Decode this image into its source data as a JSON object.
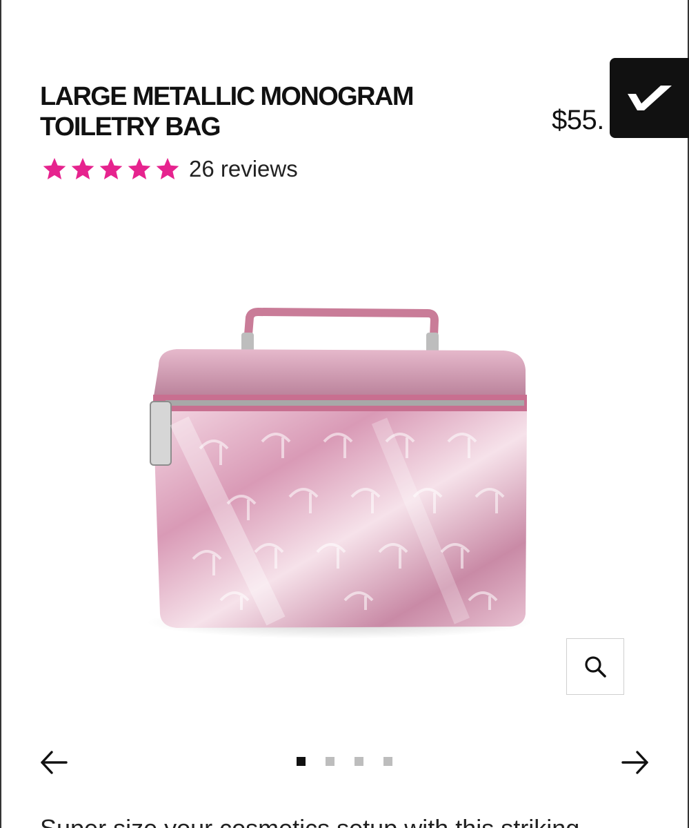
{
  "product": {
    "title_line1": "LARGE METALLIC MONOGRAM",
    "title_line2": "TOILETRY BAG",
    "price": "$55.",
    "rating": {
      "stars": 5,
      "max_stars": 5,
      "reviews_label": "26 reviews"
    },
    "image_alt": "pink metallic monogram toiletry bag",
    "description_partial": "Super size your cosmetics setup with this striking"
  },
  "gallery": {
    "slide_count": 4,
    "active_index": 0
  },
  "colors": {
    "star": "#e6238e",
    "bag_pink": "#e8b6cc",
    "badge": "#111111"
  },
  "icons": {
    "badge": "checkmark-icon",
    "zoom": "search-icon",
    "prev": "arrow-left-icon",
    "next": "arrow-right-icon"
  }
}
